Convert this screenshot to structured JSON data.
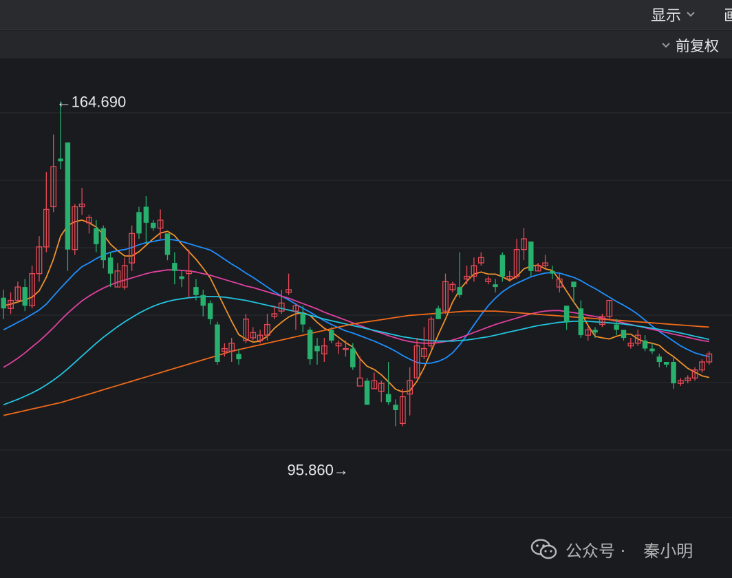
{
  "toolbar": {
    "display_label": "显示",
    "cut_label": "画",
    "adjust_label": "前复权"
  },
  "icons": {
    "dropdown": "chevron-down-icon",
    "watermark": "wechat-icon"
  },
  "watermark": {
    "label": "公众号 ·",
    "author": "秦小明"
  },
  "chart_data": {
    "type": "candlestick",
    "title": "",
    "xlabel": "",
    "ylabel": "",
    "ylim": [
      80,
      170
    ],
    "grid": true,
    "up_color": "#e84b57",
    "down_color": "#27b06e",
    "annotations": [
      {
        "text": "←164.690",
        "value": 164.69,
        "index": 7,
        "kind": "high"
      },
      {
        "text": "95.860→",
        "value": 95.86,
        "index": 49,
        "kind": "low"
      }
    ],
    "candles": [
      [
        128.0,
        126.0,
        129.5,
        124.0
      ],
      [
        126.0,
        127.5,
        129.0,
        125.0
      ],
      [
        127.5,
        130.0,
        131.0,
        127.0
      ],
      [
        130.0,
        126.5,
        131.5,
        125.5
      ],
      [
        126.5,
        132.5,
        134.0,
        126.0
      ],
      [
        132.5,
        137.5,
        139.5,
        131.0
      ],
      [
        137.5,
        144.5,
        151.5,
        136.5
      ],
      [
        145.0,
        152.5,
        158.5,
        144.0
      ],
      [
        154.0,
        153.5,
        164.69,
        152.0
      ],
      [
        157.0,
        137.0,
        157.0,
        133.0
      ],
      [
        137.0,
        145.0,
        145.5,
        136.0
      ],
      [
        145.0,
        145.5,
        148.5,
        143.5
      ],
      [
        142.0,
        143.0,
        143.5,
        140.0
      ],
      [
        141.0,
        138.0,
        142.5,
        136.5
      ],
      [
        141.0,
        135.0,
        141.5,
        133.5
      ],
      [
        135.5,
        132.5,
        136.5,
        130.0
      ],
      [
        130.0,
        133.0,
        134.5,
        130.0
      ],
      [
        130.0,
        134.0,
        135.5,
        129.5
      ],
      [
        134.5,
        140.0,
        141.5,
        133.0
      ],
      [
        144.0,
        140.0,
        145.0,
        139.0
      ],
      [
        145.0,
        142.0,
        147.0,
        138.0
      ],
      [
        142.0,
        141.0,
        142.5,
        140.5
      ],
      [
        141.0,
        142.5,
        144.5,
        139.0
      ],
      [
        140.0,
        136.0,
        140.0,
        135.0
      ],
      [
        134.5,
        133.0,
        136.5,
        130.5
      ],
      [
        132.0,
        131.5,
        133.0,
        130.0
      ],
      [
        132.5,
        133.0,
        137.0,
        128.0
      ],
      [
        130.0,
        128.5,
        131.5,
        127.5
      ],
      [
        128.5,
        126.5,
        129.5,
        124.5
      ],
      [
        127.0,
        124.0,
        127.5,
        123.0
      ],
      [
        123.0,
        116.0,
        123.5,
        115.5
      ],
      [
        118.0,
        118.5,
        119.5,
        117.0
      ],
      [
        118.0,
        119.5,
        120.5,
        116.0
      ],
      [
        117.5,
        116.5,
        118.5,
        115.5
      ],
      [
        120.0,
        124.0,
        125.0,
        119.5
      ],
      [
        120.5,
        121.5,
        122.5,
        120.0
      ],
      [
        120.0,
        121.0,
        122.0,
        119.5
      ],
      [
        121.0,
        123.0,
        125.0,
        120.0
      ],
      [
        124.5,
        125.0,
        126.5,
        124.0
      ],
      [
        125.5,
        127.0,
        129.5,
        125.0
      ],
      [
        129.0,
        129.5,
        132.5,
        128.5
      ],
      [
        125.5,
        126.5,
        127.0,
        122.0
      ],
      [
        125.0,
        123.0,
        126.5,
        121.5
      ],
      [
        122.0,
        116.5,
        122.5,
        115.5
      ],
      [
        119.0,
        118.0,
        120.5,
        115.5
      ],
      [
        117.5,
        119.0,
        120.5,
        116.0
      ],
      [
        122.0,
        120.0,
        122.5,
        119.5
      ],
      [
        119.0,
        119.5,
        120.0,
        117.5
      ],
      [
        118.5,
        118.5,
        120.0,
        117.0
      ],
      [
        118.5,
        115.0,
        119.5,
        114.5
      ],
      [
        111.5,
        113.0,
        117.0,
        113.0
      ],
      [
        112.5,
        108.0,
        113.0,
        108.0
      ],
      [
        111.0,
        112.5,
        114.0,
        111.0
      ],
      [
        110.5,
        112.0,
        112.5,
        108.5
      ],
      [
        110.0,
        108.5,
        116.0,
        108.0
      ],
      [
        108.0,
        107.0,
        109.0,
        104.0
      ],
      [
        104.5,
        109.5,
        111.0,
        104.0
      ],
      [
        110.0,
        112.5,
        115.0,
        106.0
      ],
      [
        113.0,
        119.0,
        120.5,
        113.0
      ],
      [
        117.0,
        118.5,
        122.5,
        116.5
      ],
      [
        119.0,
        124.0,
        124.5,
        118.5
      ],
      [
        126.0,
        124.0,
        126.5,
        124.0
      ],
      [
        125.5,
        131.0,
        132.5,
        125.0
      ],
      [
        129.5,
        130.5,
        131.0,
        129.0
      ],
      [
        130.0,
        128.5,
        136.5,
        128.0
      ],
      [
        131.5,
        132.0,
        134.0,
        130.5
      ],
      [
        132.0,
        134.0,
        135.5,
        131.0
      ],
      [
        134.5,
        135.5,
        136.5,
        134.0
      ],
      [
        131.0,
        131.5,
        132.0,
        130.5
      ],
      [
        130.5,
        130.0,
        131.5,
        129.0
      ],
      [
        136.0,
        132.0,
        136.5,
        131.0
      ],
      [
        131.5,
        132.0,
        133.0,
        131.0
      ],
      [
        132.0,
        137.0,
        139.0,
        131.5
      ],
      [
        137.0,
        139.0,
        141.0,
        135.0
      ],
      [
        138.5,
        133.0,
        138.5,
        132.0
      ],
      [
        133.0,
        134.0,
        134.5,
        133.0
      ],
      [
        134.0,
        134.5,
        136.0,
        133.5
      ],
      [
        133.0,
        132.5,
        134.0,
        131.5
      ],
      [
        130.0,
        131.5,
        132.5,
        129.0
      ],
      [
        126.5,
        123.5,
        126.5,
        122.0
      ],
      [
        131.0,
        130.0,
        131.0,
        127.0
      ],
      [
        126.0,
        121.0,
        127.5,
        120.5
      ],
      [
        121.0,
        122.0,
        122.5,
        120.0
      ],
      [
        122.0,
        121.5,
        122.5,
        120.5
      ],
      [
        123.0,
        124.5,
        125.0,
        122.5
      ],
      [
        124.5,
        127.5,
        127.5,
        124.0
      ],
      [
        123.0,
        122.0,
        124.0,
        121.0
      ],
      [
        122.0,
        120.5,
        122.0,
        120.0
      ],
      [
        119.0,
        119.5,
        120.5,
        118.5
      ],
      [
        119.5,
        121.0,
        122.0,
        119.0
      ],
      [
        120.0,
        118.5,
        121.0,
        118.0
      ],
      [
        118.5,
        118.0,
        119.5,
        117.5
      ],
      [
        117.0,
        116.0,
        117.5,
        115.0
      ],
      [
        116.0,
        115.5,
        116.0,
        115.0
      ],
      [
        116.0,
        112.0,
        117.0,
        111.0
      ],
      [
        112.0,
        112.5,
        113.0,
        111.5
      ],
      [
        112.5,
        113.0,
        113.5,
        112.0
      ],
      [
        113.0,
        114.5,
        115.0,
        112.5
      ],
      [
        114.5,
        116.0,
        116.5,
        114.0
      ],
      [
        116.0,
        117.5,
        118.0,
        115.5
      ]
    ],
    "ma": [
      {
        "color": "#f0932b",
        "values": [
          126.5,
          126.8,
          127.2,
          127.6,
          128.1,
          129.3,
          131.8,
          135.2,
          139.5,
          141.5,
          142.2,
          142.5,
          142.0,
          141.2,
          139.8,
          138.0,
          136.8,
          135.8,
          135.8,
          136.6,
          137.8,
          139.0,
          140.1,
          140.4,
          139.6,
          138.0,
          136.6,
          135.2,
          133.5,
          131.7,
          129.0,
          126.3,
          123.6,
          121.1,
          120.3,
          119.7,
          119.9,
          120.8,
          122.3,
          123.4,
          124.4,
          125.0,
          125.2,
          124.7,
          123.4,
          122.3,
          121.6,
          120.6,
          119.6,
          118.8,
          116.6,
          115.2,
          114.6,
          113.6,
          112.3,
          110.9,
          110.4,
          110.6,
          112.4,
          114.9,
          118.0,
          121.1,
          124.0,
          127.2,
          129.5,
          131.1,
          132.4,
          132.8,
          132.4,
          132.4,
          131.9,
          131.2,
          132.0,
          133.4,
          133.9,
          134.1,
          133.4,
          133.1,
          131.3,
          129.2,
          127.2,
          125.3,
          122.8,
          120.8,
          120.5,
          120.3,
          120.8,
          121.2,
          121.2,
          120.3,
          119.7,
          119.5,
          119.1,
          117.9,
          117.0,
          115.9,
          114.8,
          114.1,
          113.4,
          113.1
        ]
      },
      {
        "color": "#1e90ff",
        "values": [
          122.0,
          122.7,
          123.4,
          124.1,
          124.9,
          125.7,
          126.8,
          128.3,
          129.8,
          131.2,
          132.6,
          133.8,
          134.5,
          135.3,
          136.0,
          136.5,
          136.8,
          137.0,
          137.4,
          137.9,
          138.3,
          138.5,
          138.8,
          138.9,
          138.8,
          138.5,
          138.1,
          137.7,
          137.3,
          136.9,
          136.1,
          135.2,
          134.3,
          133.5,
          132.6,
          131.8,
          130.9,
          130.0,
          129.1,
          128.3,
          127.6,
          126.8,
          126.0,
          125.3,
          124.5,
          123.7,
          123.0,
          122.4,
          121.8,
          121.4,
          120.9,
          120.4,
          119.9,
          119.3,
          118.7,
          118.0,
          117.2,
          116.5,
          115.9,
          115.7,
          115.8,
          116.1,
          116.7,
          117.7,
          119.2,
          121.0,
          122.9,
          124.8,
          126.5,
          127.9,
          129.1,
          130.0,
          130.7,
          131.3,
          131.9,
          132.3,
          132.6,
          132.7,
          132.6,
          132.2,
          131.8,
          131.2,
          130.4,
          129.7,
          128.9,
          128.1,
          127.3,
          126.6,
          125.8,
          124.9,
          123.8,
          122.7,
          121.7,
          120.8,
          119.9,
          119.0,
          118.3,
          117.7,
          117.3,
          117.0
        ]
      },
      {
        "color": "#e040a0",
        "values": [
          115.0,
          115.8,
          116.7,
          117.7,
          118.8,
          119.9,
          121.1,
          122.4,
          123.8,
          125.1,
          126.3,
          127.4,
          128.3,
          129.1,
          129.8,
          130.4,
          130.9,
          131.3,
          131.7,
          132.1,
          132.5,
          132.8,
          133.0,
          133.2,
          133.2,
          133.1,
          133.0,
          132.8,
          132.5,
          132.2,
          131.8,
          131.4,
          131.0,
          130.6,
          130.2,
          129.9,
          129.5,
          129.1,
          128.7,
          128.3,
          127.9,
          127.4,
          126.9,
          126.4,
          125.9,
          125.3,
          124.8,
          124.3,
          123.8,
          123.3,
          122.8,
          122.3,
          121.8,
          121.4,
          120.9,
          120.5,
          120.1,
          119.8,
          119.6,
          119.5,
          119.5,
          119.6,
          119.8,
          120.1,
          120.5,
          121.0,
          121.5,
          122.0,
          122.5,
          123.0,
          123.4,
          123.8,
          124.2,
          124.6,
          125.0,
          125.3,
          125.5,
          125.6,
          125.6,
          125.4,
          125.2,
          125.0,
          124.7,
          124.5,
          124.2,
          123.9,
          123.6,
          123.3,
          123.0,
          122.7,
          122.4,
          122.1,
          121.8,
          121.5,
          121.2,
          120.9,
          120.6,
          120.3,
          120.0,
          119.8
        ]
      },
      {
        "color": "#22c5e0",
        "values": [
          108.0,
          108.5,
          109.0,
          109.6,
          110.2,
          110.9,
          111.7,
          112.6,
          113.6,
          114.7,
          115.9,
          117.1,
          118.3,
          119.5,
          120.6,
          121.6,
          122.6,
          123.5,
          124.3,
          125.1,
          125.8,
          126.4,
          126.9,
          127.3,
          127.6,
          127.8,
          128.0,
          128.1,
          128.2,
          128.2,
          128.2,
          128.1,
          127.9,
          127.7,
          127.5,
          127.2,
          126.9,
          126.6,
          126.3,
          126.0,
          125.7,
          125.4,
          125.1,
          124.7,
          124.4,
          124.0,
          123.7,
          123.4,
          123.1,
          122.8,
          122.5,
          122.2,
          121.9,
          121.6,
          121.3,
          121.0,
          120.7,
          120.5,
          120.3,
          120.1,
          120.0,
          119.9,
          119.9,
          119.9,
          120.0,
          120.1,
          120.3,
          120.5,
          120.7,
          121.0,
          121.3,
          121.6,
          121.9,
          122.2,
          122.5,
          122.8,
          123.0,
          123.2,
          123.4,
          123.5,
          123.6,
          123.6,
          123.6,
          123.5,
          123.4,
          123.3,
          123.2,
          123.1,
          122.9,
          122.7,
          122.5,
          122.3,
          122.1,
          121.9,
          121.7,
          121.4,
          121.1,
          120.8,
          120.5,
          120.2
        ]
      },
      {
        "color": "#f06a1a",
        "values": [
          106.0,
          106.3,
          106.6,
          106.9,
          107.2,
          107.5,
          107.8,
          108.1,
          108.4,
          108.8,
          109.2,
          109.6,
          110.0,
          110.4,
          110.8,
          111.2,
          111.6,
          112.0,
          112.4,
          112.8,
          113.2,
          113.6,
          114.0,
          114.4,
          114.8,
          115.2,
          115.6,
          116.0,
          116.4,
          116.8,
          117.2,
          117.6,
          118.0,
          118.3,
          118.6,
          118.9,
          119.2,
          119.5,
          119.8,
          120.1,
          120.4,
          120.7,
          121.0,
          121.3,
          121.6,
          121.9,
          122.2,
          122.5,
          122.8,
          123.1,
          123.3,
          123.5,
          123.7,
          123.9,
          124.1,
          124.3,
          124.5,
          124.7,
          124.8,
          124.9,
          125.0,
          125.1,
          125.2,
          125.3,
          125.4,
          125.5,
          125.5,
          125.5,
          125.5,
          125.5,
          125.4,
          125.3,
          125.2,
          125.1,
          125.0,
          124.9,
          124.8,
          124.7,
          124.6,
          124.5,
          124.4,
          124.3,
          124.2,
          124.1,
          124.0,
          123.9,
          123.8,
          123.7,
          123.6,
          123.5,
          123.4,
          123.3,
          123.2,
          123.1,
          123.0,
          122.9,
          122.8,
          122.7,
          122.6,
          122.5
        ]
      }
    ]
  }
}
